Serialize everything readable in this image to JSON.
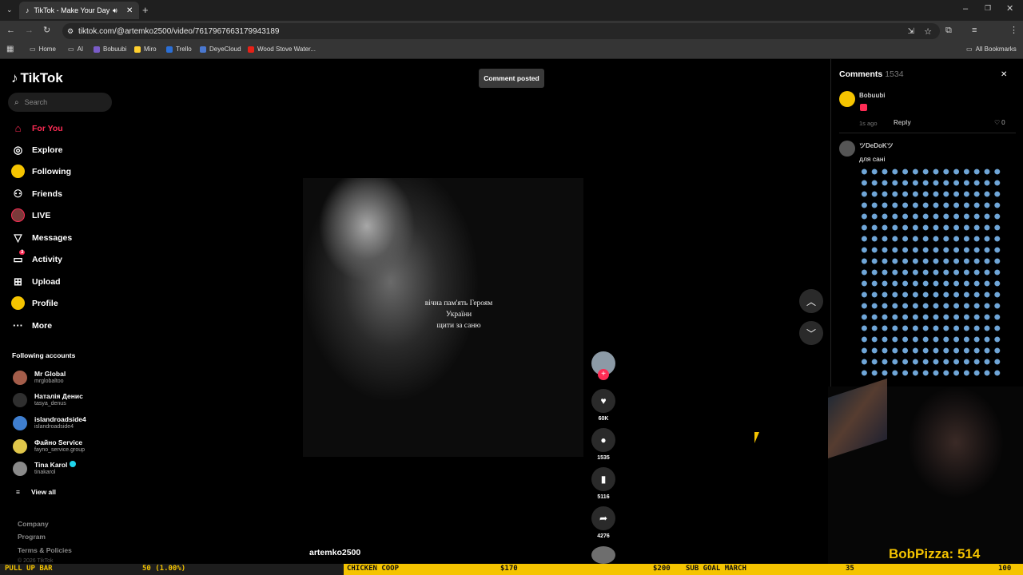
{
  "browser": {
    "tab_title": "TikTok - Make Your Day",
    "url": "tiktok.com/@artemko2500/video/7617967663179943189",
    "bookmarks": [
      "Home",
      "AI",
      "Bobuubi",
      "Miro",
      "Trello",
      "DeyeCloud",
      "Wood Stove Water..."
    ],
    "all_bookmarks": "All Bookmarks"
  },
  "sidebar": {
    "logo": "TikTok",
    "search_placeholder": "Search",
    "nav": [
      {
        "label": "For You",
        "icon": "home-icon",
        "active": true
      },
      {
        "label": "Explore",
        "icon": "compass-icon"
      },
      {
        "label": "Following",
        "icon": "following-avatar-icon"
      },
      {
        "label": "Friends",
        "icon": "friends-icon"
      },
      {
        "label": "LIVE",
        "icon": "live-icon"
      },
      {
        "label": "Messages",
        "icon": "paper-plane-icon"
      },
      {
        "label": "Activity",
        "icon": "activity-icon",
        "badge": "3"
      },
      {
        "label": "Upload",
        "icon": "plus-square-icon"
      },
      {
        "label": "Profile",
        "icon": "profile-icon"
      },
      {
        "label": "More",
        "icon": "ellipsis-icon"
      }
    ],
    "following_title": "Following accounts",
    "accounts": [
      {
        "name": "Mr Global",
        "handle": "mrglobaltoo"
      },
      {
        "name": "Наталія Денис",
        "handle": "tasya_denus"
      },
      {
        "name": "islandroadside4",
        "handle": "islandroadside4"
      },
      {
        "name": "Файно Service",
        "handle": "fayno_service.group"
      },
      {
        "name": "Tina Karol",
        "handle": "tinakarol",
        "verified": true
      }
    ],
    "view_all": "View all",
    "footer": [
      "Company",
      "Program",
      "Terms & Policies",
      "© 2026 TikTok"
    ]
  },
  "main": {
    "toast": "Comment posted",
    "video_caption": [
      "вічна пам'ять Героям",
      "України",
      "щити за саню"
    ],
    "author": "artemko2500",
    "actions": {
      "likes": "60K",
      "comments": "1535",
      "saves": "5116",
      "shares": "4276"
    }
  },
  "comments": {
    "title": "Comments",
    "count": "1534",
    "items": [
      {
        "user": "Bobuubi",
        "time": "1s ago",
        "reply": "Reply",
        "likes": "0"
      },
      {
        "user": "ツDeDoKツ",
        "text": "для сані"
      }
    ]
  },
  "overlay": {
    "bob_label": "BobPizza: 514",
    "ticker": [
      {
        "text": "PULL UP BAR"
      },
      {
        "text": "50 (1.00%)"
      },
      {
        "text": "CHICKEN COOP"
      },
      {
        "text": "$170"
      },
      {
        "text": "$200"
      },
      {
        "text": "SUB GOAL MARCH"
      },
      {
        "text": "35"
      },
      {
        "text": "100"
      }
    ]
  },
  "colors": {
    "accent": "#fe2c55",
    "ticker_yellow": "#f5c400",
    "comment_pink": "#fe2c55"
  }
}
